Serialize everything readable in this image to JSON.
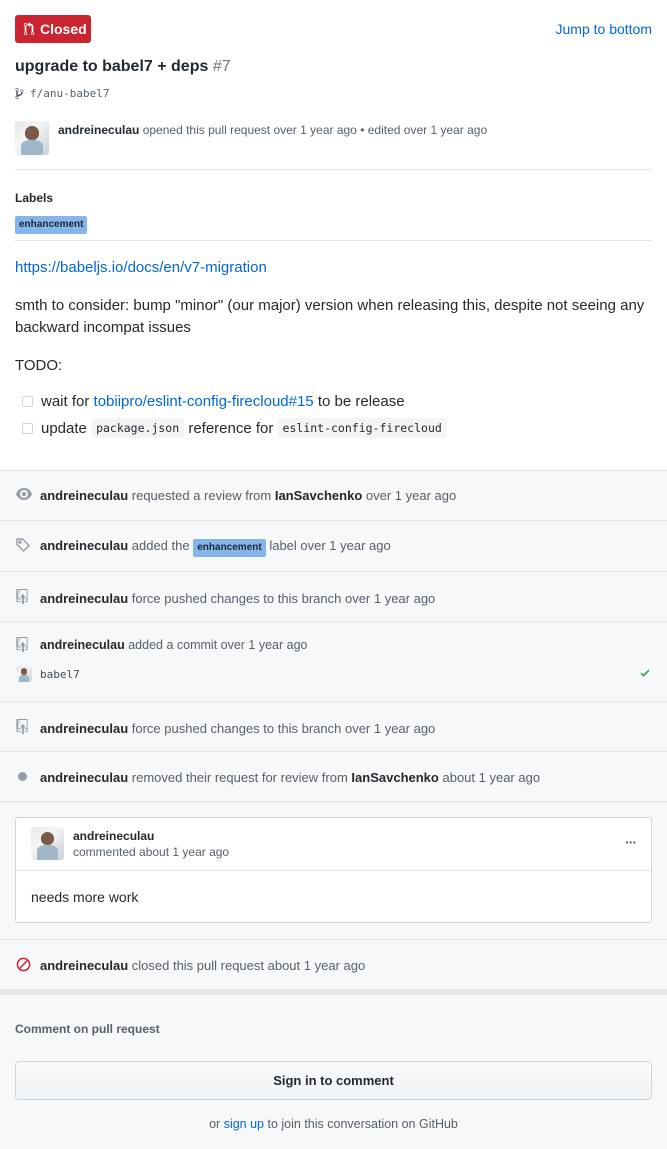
{
  "pr": {
    "state": "Closed",
    "jump_label": "Jump to bottom",
    "title": "upgrade to babel7 + deps",
    "number": "#7",
    "branch": "f/anu-babel7",
    "author": "andreineculau",
    "opened_text": "opened this pull request over 1 year ago",
    "edited_text": "• edited over 1 year ago"
  },
  "labels": {
    "heading": "Labels",
    "items": [
      "enhancement"
    ]
  },
  "description": {
    "link": "https://babeljs.io/docs/en/v7-migration",
    "paragraph": "smth to consider: bump \"minor\" (our major) version when releasing this, despite not seeing any backward incompat issues",
    "todo_heading": "TODO:",
    "task1": {
      "prefix": "wait for",
      "link": "tobiipro/eslint-config-firecloud#15",
      "suffix": "to be release"
    },
    "task2": {
      "prefix": "update",
      "code1": "package.json",
      "middle": "reference for",
      "code2": "eslint-config-firecloud"
    }
  },
  "timeline": {
    "review_request": {
      "actor": "andreineculau",
      "text": "requested a review from",
      "target": "IanSavchenko",
      "time": "over 1 year ago"
    },
    "labeled": {
      "actor": "andreineculau",
      "text": "added the",
      "label": "enhancement",
      "suffix": "label over 1 year ago"
    },
    "force_push_1": {
      "actor": "andreineculau",
      "text": "force pushed changes to this branch over 1 year ago"
    },
    "commit": {
      "actor": "andreineculau",
      "text": "added a commit over 1 year ago",
      "commit_msg": "babel7"
    },
    "force_push_2": {
      "actor": "andreineculau",
      "text": "force pushed changes to this branch over 1 year ago"
    },
    "review_removed": {
      "actor": "andreineculau",
      "text": "removed their request for review from",
      "target": "IanSavchenko",
      "time": "about 1 year ago"
    },
    "comment": {
      "author": "andreineculau",
      "meta": "commented about 1 year ago",
      "body": "needs more work",
      "menu": "···"
    },
    "closed": {
      "actor": "andreineculau",
      "text": "closed this pull request about 1 year ago"
    }
  },
  "footer": {
    "heading": "Comment on pull request",
    "signin_label": "Sign in to comment",
    "or": "or",
    "signup": "sign up",
    "suffix": "to join this conversation on GitHub"
  },
  "colors": {
    "closed": "#cb2431",
    "link": "#0366d6",
    "label": "#84b6eb",
    "success": "#28a745"
  }
}
